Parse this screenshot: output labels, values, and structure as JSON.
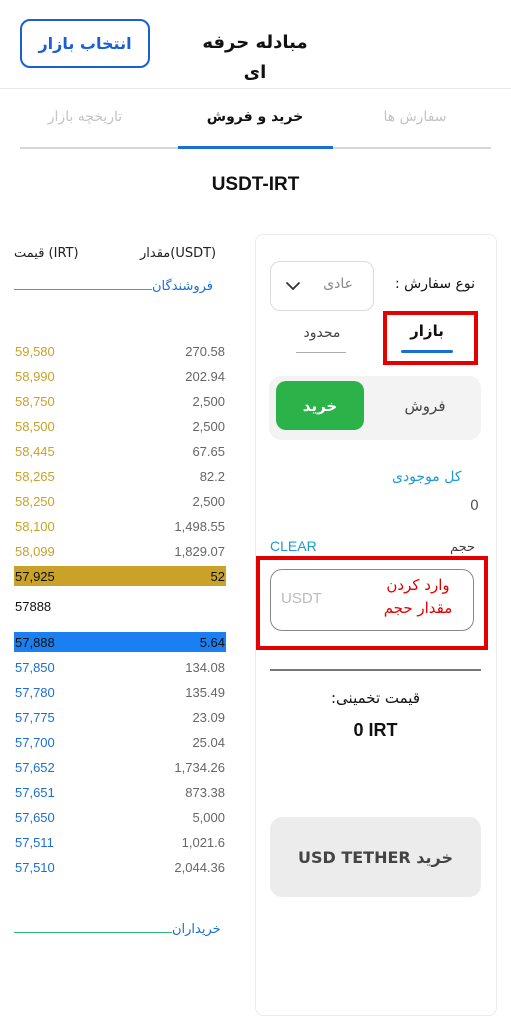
{
  "header": {
    "title": "مبادله حرفه ای",
    "select_market_label": "انتخاب بازار"
  },
  "tabs": [
    {
      "label": "سفارش ها",
      "active": false
    },
    {
      "label": "خرید و فروش",
      "active": true
    },
    {
      "label": "تاریخچه بازار",
      "active": false
    }
  ],
  "pair": "USDT-IRT",
  "order_book": {
    "amount_header": "مقدار(USDT)",
    "price_header": "قیمت (IRT)",
    "sellers_label": "فروشندگان",
    "buyers_label": "خریداران",
    "mid_price": "57888",
    "asks": [
      {
        "price": "59,580",
        "amount": "270.58"
      },
      {
        "price": "58,990",
        "amount": "202.94"
      },
      {
        "price": "58,750",
        "amount": "2,500"
      },
      {
        "price": "58,500",
        "amount": "2,500"
      },
      {
        "price": "58,445",
        "amount": "67.65"
      },
      {
        "price": "58,265",
        "amount": "82.2"
      },
      {
        "price": "58,250",
        "amount": "2,500"
      },
      {
        "price": "58,100",
        "amount": "1,498.55"
      },
      {
        "price": "58,099",
        "amount": "1,829.07"
      },
      {
        "price": "57,925",
        "amount": "52"
      }
    ],
    "bids": [
      {
        "price": "57,888",
        "amount": "5.64"
      },
      {
        "price": "57,850",
        "amount": "134.08"
      },
      {
        "price": "57,780",
        "amount": "135.49"
      },
      {
        "price": "57,775",
        "amount": "23.09"
      },
      {
        "price": "57,700",
        "amount": "25.04"
      },
      {
        "price": "57,652",
        "amount": "1,734.26"
      },
      {
        "price": "57,651",
        "amount": "873.38"
      },
      {
        "price": "57,650",
        "amount": "5,000"
      },
      {
        "price": "57,511",
        "amount": "1,021.6"
      },
      {
        "price": "57,510",
        "amount": "2,044.36"
      }
    ]
  },
  "order_form": {
    "order_type_label": "نوع سفارش :",
    "order_type_value": "عادی",
    "mode_market": "بازار",
    "mode_limit": "محدود",
    "buy_label": "خرید",
    "sell_label": "فروش",
    "balance_label": "کل موجودی",
    "balance_value": "0",
    "volume_label": "حجم",
    "clear_label": "CLEAR",
    "volume_placeholder": "USDT",
    "annotation_line1": "وارد کردن",
    "annotation_line2": "مقدار حجم",
    "estimated_label": "قیمت تخمینی:",
    "estimated_value": "0 IRT",
    "submit_label": "خرید USD TETHER"
  },
  "colors": {
    "accent": "#1a6fd6",
    "buy": "#2bb34a",
    "ask": "#c9a227",
    "annotation": "#e50000"
  }
}
